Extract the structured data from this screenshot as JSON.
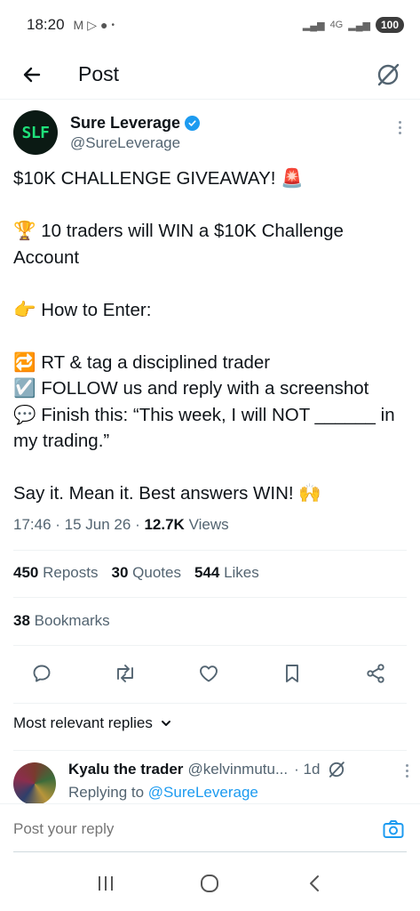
{
  "status_bar": {
    "time": "18:20",
    "network": "4G",
    "battery": "100"
  },
  "header": {
    "title": "Post"
  },
  "tweet": {
    "avatar_text": "SLF",
    "display_name": "Sure Leverage",
    "handle": "@SureLeverage",
    "lines": [
      "$10K CHALLENGE GIVEAWAY! 🚨",
      "",
      "🏆 10 traders will WIN a $10K Challenge Account",
      "",
      "👉 How to Enter:",
      "",
      "🔁 RT & tag a disciplined trader",
      "☑️ FOLLOW us and reply with a screenshot",
      "💬 Finish this: “This week, I will NOT ______ in my trading.”",
      "",
      "Say it. Mean it. Best answers WIN! 🙌"
    ],
    "time": "17:46",
    "date": "15 Jun 26",
    "views_count": "12.7K",
    "views_label": "Views"
  },
  "stats": {
    "reposts_count": "450",
    "reposts_label": "Reposts",
    "quotes_count": "30",
    "quotes_label": "Quotes",
    "likes_count": "544",
    "likes_label": "Likes",
    "bookmarks_count": "38",
    "bookmarks_label": "Bookmarks"
  },
  "replies": {
    "sort_label": "Most relevant replies",
    "items": [
      {
        "name": "Kyalu the trader",
        "handle": "@kelvinmutu...",
        "time": "· 1d",
        "replying_prefix": "Replying to",
        "replying_to": "@SureLeverage"
      }
    ]
  },
  "compose": {
    "placeholder": "Post your reply"
  },
  "colors": {
    "accent": "#1d9bf0",
    "text_primary": "#0f1419",
    "text_secondary": "#536471",
    "avatar_green": "#1fe07a"
  },
  "icons": [
    "back-arrow-icon",
    "grok-icon",
    "verified-badge-icon",
    "more-icon",
    "reply-icon",
    "repost-icon",
    "like-icon",
    "bookmark-icon",
    "share-icon",
    "chevron-down-icon",
    "camera-icon",
    "recents-icon",
    "home-icon",
    "back-nav-icon"
  ]
}
